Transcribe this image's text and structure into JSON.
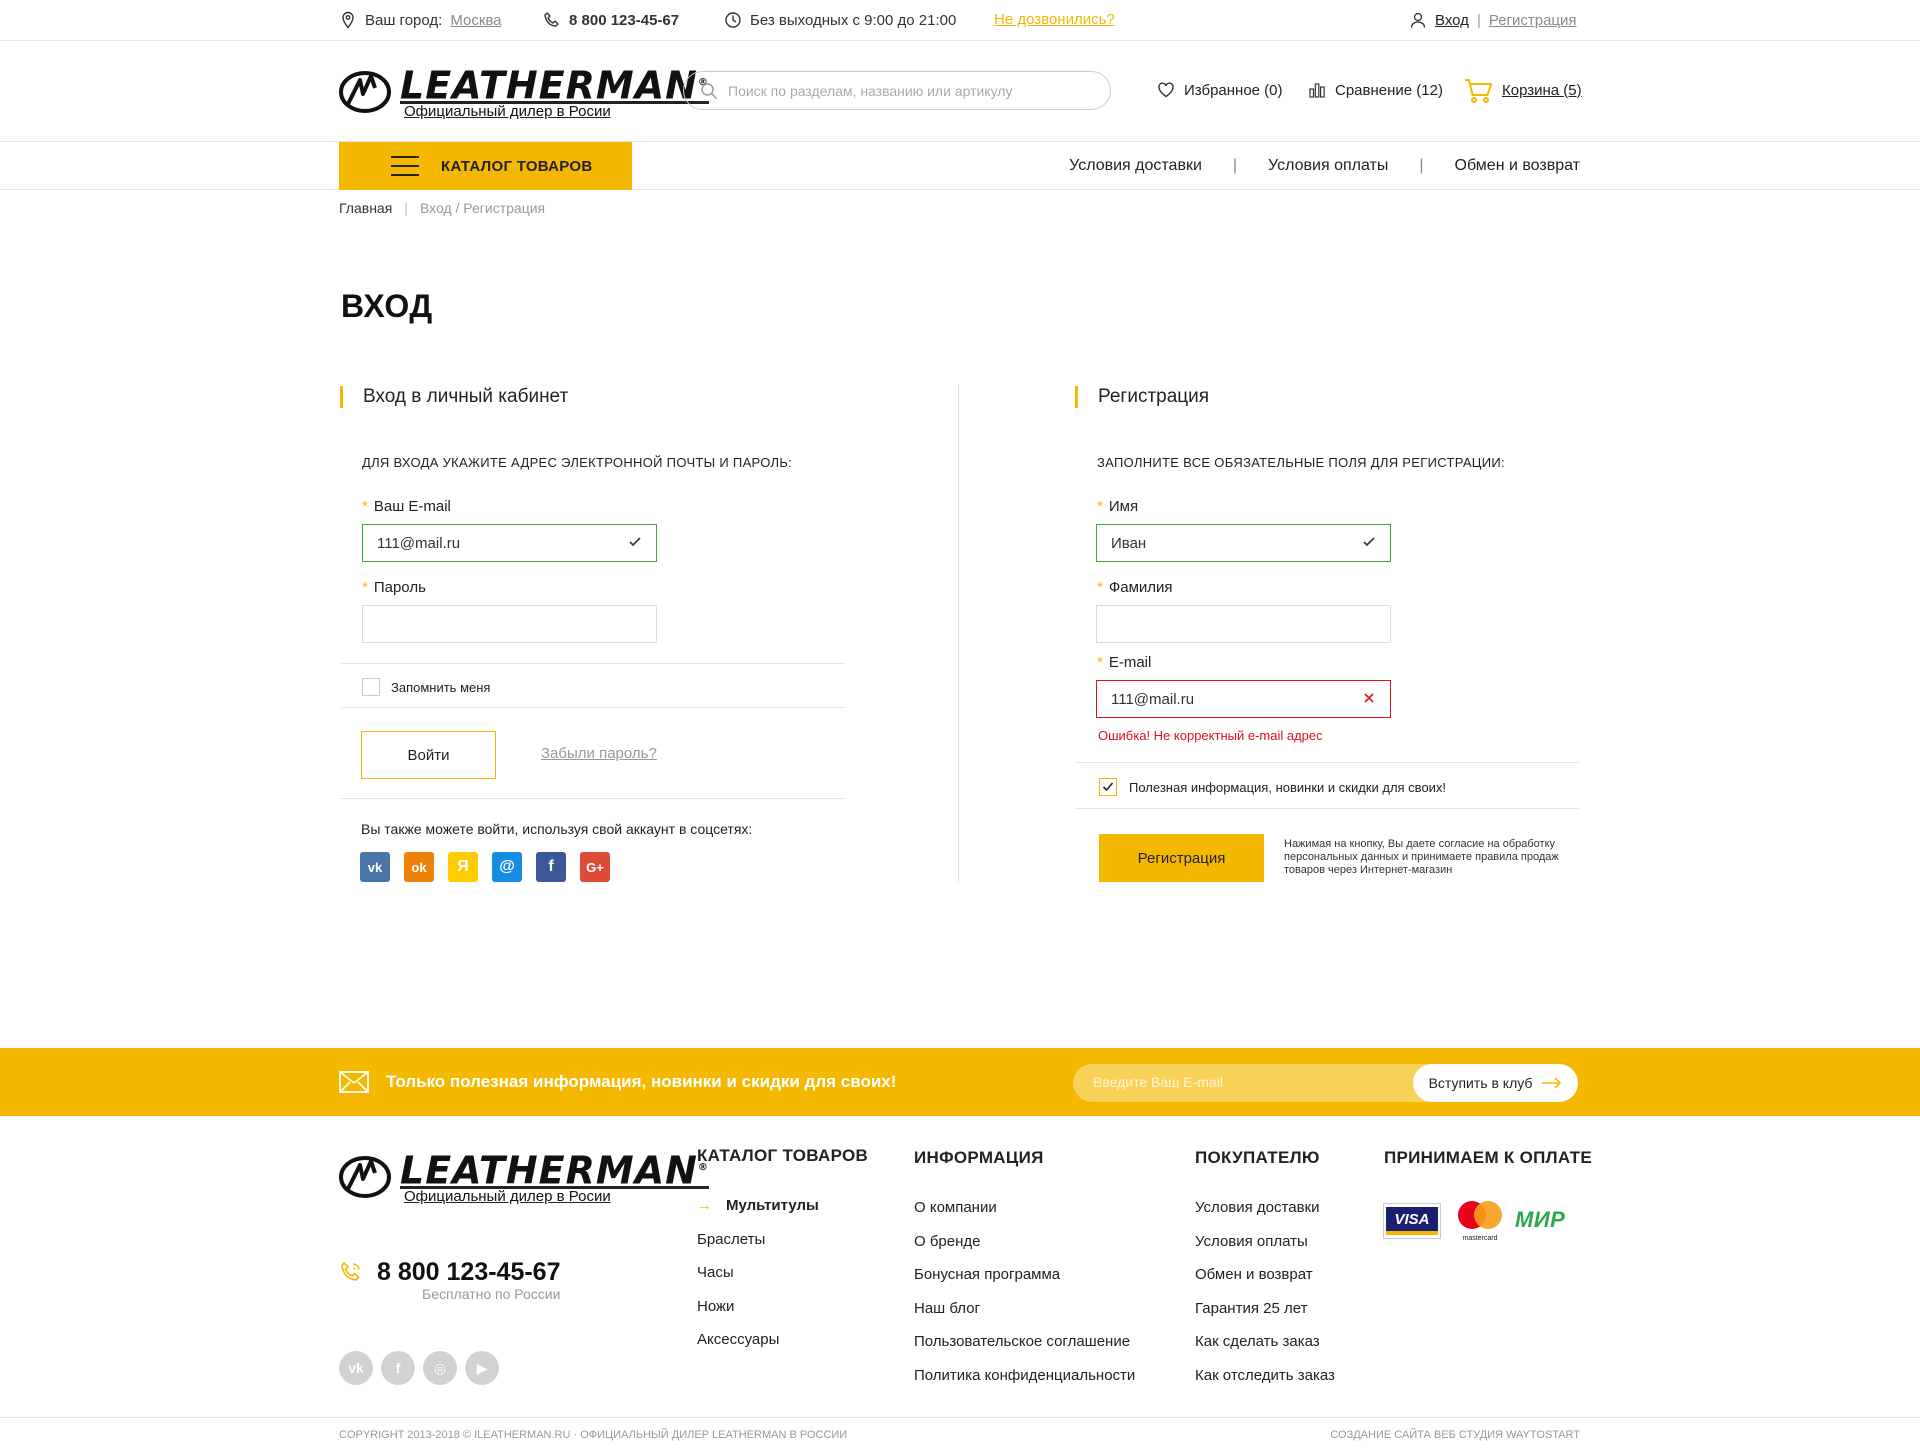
{
  "topbar": {
    "city_label": "Ваш город:",
    "city": "Москва",
    "phone": "8 800 123-45-67",
    "hours": "Без выходных с 9:00 до 21:00",
    "callback": "Не дозвонились?",
    "login": "Вход",
    "divider": "|",
    "register": "Регистрация"
  },
  "header": {
    "logo_text": "LEATHERMAN",
    "logo_reg": "®",
    "logo_sub": "Официальный дилер в Росии",
    "search_placeholder": "Поиск по разделам, названию или артикулу",
    "favorites": "Избранное (0)",
    "compare": "Сравнение (12)",
    "cart": "Корзина (5)"
  },
  "nav": {
    "catalog": "КАТАЛОГ ТОВАРОВ",
    "links": [
      "Условия доставки",
      "Условия оплаты",
      "Обмен и возврат"
    ],
    "sep": "|"
  },
  "breadcrumb": {
    "home": "Главная",
    "sep": "|",
    "current": "Вход / Регистрация"
  },
  "page_title": "ВХОД",
  "login": {
    "title": "Вход в личный кабинет",
    "hint": "ДЛЯ ВХОДА УКАЖИТЕ АДРЕС ЭЛЕКТРОННОЙ ПОЧТЫ И ПАРОЛЬ:",
    "required_mark": "*",
    "email_label": "Ваш E-mail",
    "email_value": "111@mail.ru",
    "password_label": "Пароль",
    "password_value": "",
    "remember": "Запомнить меня",
    "remember_checked": false,
    "submit": "Войти",
    "forgot": "Забыли пароль?",
    "social_text": "Вы также можете войти, используя свой аккаунт в соцсетях:",
    "socials": [
      {
        "icon": "vk-icon",
        "glyph": "vk",
        "color": "#4a76a8"
      },
      {
        "icon": "odnoklassniki-icon",
        "glyph": "ok",
        "color": "#ee8208"
      },
      {
        "icon": "yandex-icon",
        "glyph": "Я",
        "color": "#ffcc00"
      },
      {
        "icon": "mailru-icon",
        "glyph": "@",
        "color": "#168de2"
      },
      {
        "icon": "facebook-icon",
        "glyph": "f",
        "color": "#3b5998"
      },
      {
        "icon": "google-plus-icon",
        "glyph": "G+",
        "color": "#dd4b39"
      }
    ]
  },
  "register": {
    "title": "Регистрация",
    "hint": "ЗАПОЛНИТЕ ВСЕ ОБЯЗАТЕЛЬНЫЕ ПОЛЯ ДЛЯ РЕГИСТРАЦИИ:",
    "required_mark": "*",
    "name_label": "Имя",
    "name_value": "Иван",
    "surname_label": "Фамилия",
    "surname_value": "",
    "email_label": "E-mail",
    "email_value": "111@mail.ru",
    "email_error": "Ошибка! Не корректный e-mail адрес",
    "newsletter": "Полезная информация, новинки и скидки для своих!",
    "newsletter_checked": true,
    "submit": "Регистрация",
    "consent": "Нажимая на кнопку, Вы даете согласие на обработку персональных данных и принимаете правила продаж товаров через Интернет-магазин"
  },
  "promo": {
    "text": "Только полезная информация, новинки и скидки для своих!",
    "placeholder": "Введите Ваш E-mail",
    "button": "Вступить в клуб"
  },
  "footer": {
    "logo_text": "LEATHERMAN",
    "logo_reg": "®",
    "logo_sub": "Официальный дилер в Росии",
    "phone": "8 800 123-45-67",
    "phone_note": "Бесплатно по России",
    "catalog": {
      "title": "КАТАЛОГ ТОВАРОВ",
      "items": [
        "Мультитулы",
        "Браслеты",
        "Часы",
        "Ножи",
        "Аксессуары"
      ],
      "active": 0
    },
    "info": {
      "title": "ИНФОРМАЦИЯ",
      "items": [
        "О компании",
        "О бренде",
        "Бонусная программа",
        "Наш блог",
        "Пользовательское соглашение",
        "Политика конфиденциальности"
      ]
    },
    "buyer": {
      "title": "ПОКУПАТЕЛЮ",
      "items": [
        "Условия доставки",
        "Условия оплаты",
        "Обмен и возврат",
        "Гарантия 25 лет",
        "Как сделать заказ",
        "Как отследить заказ"
      ]
    },
    "payment": {
      "title": "ПРИНИМАЕМ К ОПЛАТЕ",
      "visa": "VISA",
      "mastercard": "mastercard",
      "mir": "МИР"
    },
    "socials": [
      "vk-icon",
      "facebook-icon",
      "instagram-icon",
      "youtube-icon"
    ],
    "copyright": "COPYRIGHT 2013-2018 © ILEATHERMAN.RU · ОФИЦИАЛЬНЫЙ ДИЛЕР LEATHERMAN В РОССИИ",
    "credits": "СОЗДАНИЕ САЙТА ВЕБ СТУДИЯ WAYTOSTART"
  },
  "colors": {
    "accent": "#f5b800",
    "ok": "#3aaa35",
    "error": "#e0101e"
  }
}
